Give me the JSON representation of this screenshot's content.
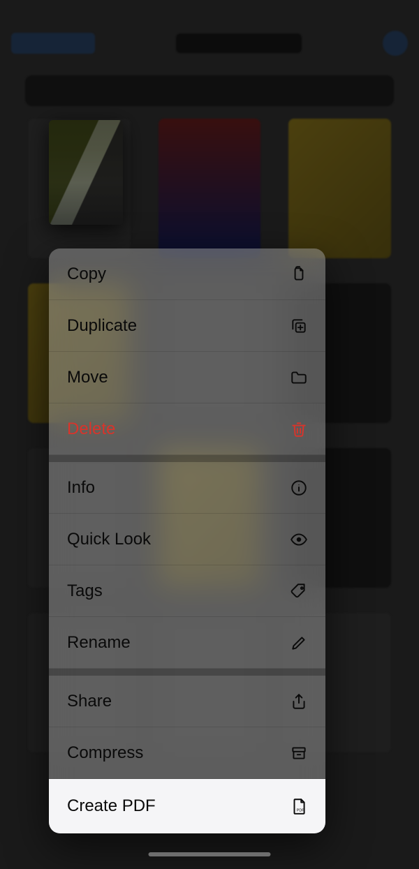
{
  "selected_preview": {
    "kind": "image-thumbnail"
  },
  "menu": {
    "items": [
      {
        "label": "Copy",
        "icon": "copy-doc-icon",
        "destructive": false
      },
      {
        "label": "Duplicate",
        "icon": "duplicate-icon",
        "destructive": false
      },
      {
        "label": "Move",
        "icon": "folder-icon",
        "destructive": false
      },
      {
        "label": "Delete",
        "icon": "trash-icon",
        "destructive": true
      },
      {
        "label": "Info",
        "icon": "info-icon",
        "destructive": false
      },
      {
        "label": "Quick Look",
        "icon": "eye-icon",
        "destructive": false
      },
      {
        "label": "Tags",
        "icon": "tag-icon",
        "destructive": false
      },
      {
        "label": "Rename",
        "icon": "pencil-icon",
        "destructive": false
      },
      {
        "label": "Share",
        "icon": "share-icon",
        "destructive": false
      },
      {
        "label": "Compress",
        "icon": "archive-icon",
        "destructive": false
      },
      {
        "label": "Create PDF",
        "icon": "pdf-icon",
        "destructive": false,
        "highlighted": true
      }
    ]
  }
}
